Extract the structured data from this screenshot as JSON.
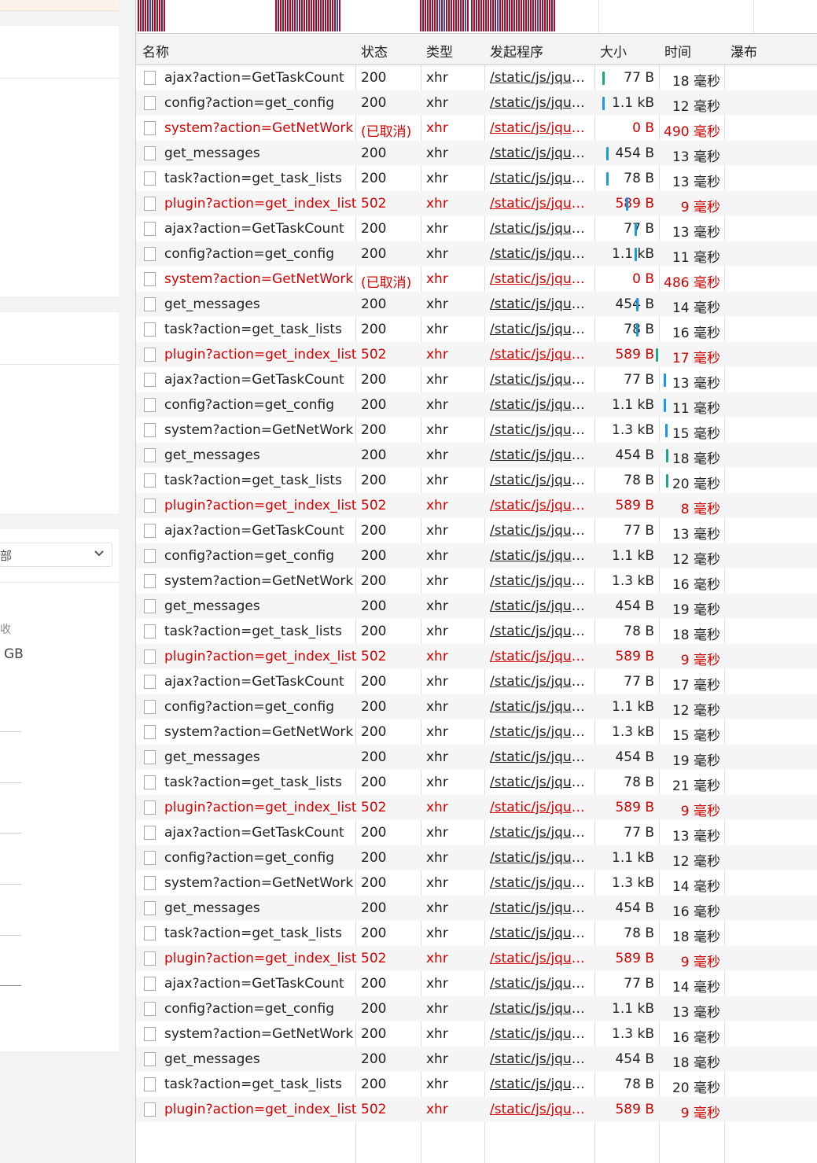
{
  "left_panel": {
    "filter_value": "部",
    "stat_label": "收",
    "stat_value": "GB"
  },
  "network": {
    "columns": {
      "name": "名称",
      "status": "状态",
      "type": "类型",
      "initiator": "发起程序",
      "size": "大小",
      "time": "时间",
      "waterfall": "瀑布"
    },
    "rows": [
      {
        "name": "ajax?action=GetTaskCount",
        "status": "200",
        "type": "xhr",
        "initiator": "/static/js/jquery",
        "size": "77 B",
        "time": "18 毫秒",
        "error": false,
        "waterfall": "teal"
      },
      {
        "name": "config?action=get_config",
        "status": "200",
        "type": "xhr",
        "initiator": "/static/js/jquery",
        "size": "1.1 kB",
        "time": "12 毫秒",
        "error": false,
        "waterfall": "blue"
      },
      {
        "name": "system?action=GetNetWork",
        "status": "(已取消)",
        "type": "xhr",
        "initiator": "/static/js/jquery",
        "size": "0 B",
        "time": "490 毫秒",
        "error": true,
        "waterfall": "none"
      },
      {
        "name": "get_messages",
        "status": "200",
        "type": "xhr",
        "initiator": "/static/js/jquery",
        "size": "454 B",
        "time": "13 毫秒",
        "error": false,
        "waterfall": "blue"
      },
      {
        "name": "task?action=get_task_lists",
        "status": "200",
        "type": "xhr",
        "initiator": "/static/js/jquery",
        "size": "78 B",
        "time": "13 毫秒",
        "error": false,
        "waterfall": "blue"
      },
      {
        "name": "plugin?action=get_index_list",
        "status": "502",
        "type": "xhr",
        "initiator": "/static/js/jquery",
        "size": "589 B",
        "time": "9 毫秒",
        "error": true,
        "waterfall": "blue"
      },
      {
        "name": "ajax?action=GetTaskCount",
        "status": "200",
        "type": "xhr",
        "initiator": "/static/js/jquery",
        "size": "77 B",
        "time": "13 毫秒",
        "error": false,
        "waterfall": "blue"
      },
      {
        "name": "config?action=get_config",
        "status": "200",
        "type": "xhr",
        "initiator": "/static/js/jquery",
        "size": "1.1 kB",
        "time": "11 毫秒",
        "error": false,
        "waterfall": "blue"
      },
      {
        "name": "system?action=GetNetWork",
        "status": "(已取消)",
        "type": "xhr",
        "initiator": "/static/js/jquery",
        "size": "0 B",
        "time": "486 毫秒",
        "error": true,
        "waterfall": "none"
      },
      {
        "name": "get_messages",
        "status": "200",
        "type": "xhr",
        "initiator": "/static/js/jquery",
        "size": "454 B",
        "time": "14 毫秒",
        "error": false,
        "waterfall": "blue"
      },
      {
        "name": "task?action=get_task_lists",
        "status": "200",
        "type": "xhr",
        "initiator": "/static/js/jquery",
        "size": "78 B",
        "time": "16 毫秒",
        "error": false,
        "waterfall": "blue"
      },
      {
        "name": "plugin?action=get_index_list",
        "status": "502",
        "type": "xhr",
        "initiator": "/static/js/jquery",
        "size": "589 B",
        "time": "17 毫秒",
        "error": true,
        "waterfall": "teal"
      },
      {
        "name": "ajax?action=GetTaskCount",
        "status": "200",
        "type": "xhr",
        "initiator": "/static/js/jquery",
        "size": "77 B",
        "time": "13 毫秒",
        "error": false,
        "waterfall": "blue"
      },
      {
        "name": "config?action=get_config",
        "status": "200",
        "type": "xhr",
        "initiator": "/static/js/jquery",
        "size": "1.1 kB",
        "time": "11 毫秒",
        "error": false,
        "waterfall": "blue"
      },
      {
        "name": "system?action=GetNetWork",
        "status": "200",
        "type": "xhr",
        "initiator": "/static/js/jquery",
        "size": "1.3 kB",
        "time": "15 毫秒",
        "error": false,
        "waterfall": "blue"
      },
      {
        "name": "get_messages",
        "status": "200",
        "type": "xhr",
        "initiator": "/static/js/jquery",
        "size": "454 B",
        "time": "18 毫秒",
        "error": false,
        "waterfall": "teal"
      },
      {
        "name": "task?action=get_task_lists",
        "status": "200",
        "type": "xhr",
        "initiator": "/static/js/jquery",
        "size": "78 B",
        "time": "20 毫秒",
        "error": false,
        "waterfall": "teal"
      },
      {
        "name": "plugin?action=get_index_list",
        "status": "502",
        "type": "xhr",
        "initiator": "/static/js/jquery",
        "size": "589 B",
        "time": "8 毫秒",
        "error": true,
        "waterfall": "none"
      },
      {
        "name": "ajax?action=GetTaskCount",
        "status": "200",
        "type": "xhr",
        "initiator": "/static/js/jquery",
        "size": "77 B",
        "time": "13 毫秒",
        "error": false,
        "waterfall": "none"
      },
      {
        "name": "config?action=get_config",
        "status": "200",
        "type": "xhr",
        "initiator": "/static/js/jquery",
        "size": "1.1 kB",
        "time": "12 毫秒",
        "error": false,
        "waterfall": "none"
      },
      {
        "name": "system?action=GetNetWork",
        "status": "200",
        "type": "xhr",
        "initiator": "/static/js/jquery",
        "size": "1.3 kB",
        "time": "16 毫秒",
        "error": false,
        "waterfall": "none"
      },
      {
        "name": "get_messages",
        "status": "200",
        "type": "xhr",
        "initiator": "/static/js/jquery",
        "size": "454 B",
        "time": "19 毫秒",
        "error": false,
        "waterfall": "none"
      },
      {
        "name": "task?action=get_task_lists",
        "status": "200",
        "type": "xhr",
        "initiator": "/static/js/jquery",
        "size": "78 B",
        "time": "18 毫秒",
        "error": false,
        "waterfall": "none"
      },
      {
        "name": "plugin?action=get_index_list",
        "status": "502",
        "type": "xhr",
        "initiator": "/static/js/jquery",
        "size": "589 B",
        "time": "9 毫秒",
        "error": true,
        "waterfall": "none"
      },
      {
        "name": "ajax?action=GetTaskCount",
        "status": "200",
        "type": "xhr",
        "initiator": "/static/js/jquery",
        "size": "77 B",
        "time": "17 毫秒",
        "error": false,
        "waterfall": "none"
      },
      {
        "name": "config?action=get_config",
        "status": "200",
        "type": "xhr",
        "initiator": "/static/js/jquery",
        "size": "1.1 kB",
        "time": "12 毫秒",
        "error": false,
        "waterfall": "none"
      },
      {
        "name": "system?action=GetNetWork",
        "status": "200",
        "type": "xhr",
        "initiator": "/static/js/jquery",
        "size": "1.3 kB",
        "time": "15 毫秒",
        "error": false,
        "waterfall": "none"
      },
      {
        "name": "get_messages",
        "status": "200",
        "type": "xhr",
        "initiator": "/static/js/jquery",
        "size": "454 B",
        "time": "19 毫秒",
        "error": false,
        "waterfall": "none"
      },
      {
        "name": "task?action=get_task_lists",
        "status": "200",
        "type": "xhr",
        "initiator": "/static/js/jquery",
        "size": "78 B",
        "time": "21 毫秒",
        "error": false,
        "waterfall": "none"
      },
      {
        "name": "plugin?action=get_index_list",
        "status": "502",
        "type": "xhr",
        "initiator": "/static/js/jquery",
        "size": "589 B",
        "time": "9 毫秒",
        "error": true,
        "waterfall": "none"
      },
      {
        "name": "ajax?action=GetTaskCount",
        "status": "200",
        "type": "xhr",
        "initiator": "/static/js/jquery",
        "size": "77 B",
        "time": "13 毫秒",
        "error": false,
        "waterfall": "none"
      },
      {
        "name": "config?action=get_config",
        "status": "200",
        "type": "xhr",
        "initiator": "/static/js/jquery",
        "size": "1.1 kB",
        "time": "12 毫秒",
        "error": false,
        "waterfall": "none"
      },
      {
        "name": "system?action=GetNetWork",
        "status": "200",
        "type": "xhr",
        "initiator": "/static/js/jquery",
        "size": "1.3 kB",
        "time": "14 毫秒",
        "error": false,
        "waterfall": "none"
      },
      {
        "name": "get_messages",
        "status": "200",
        "type": "xhr",
        "initiator": "/static/js/jquery",
        "size": "454 B",
        "time": "16 毫秒",
        "error": false,
        "waterfall": "none"
      },
      {
        "name": "task?action=get_task_lists",
        "status": "200",
        "type": "xhr",
        "initiator": "/static/js/jquery",
        "size": "78 B",
        "time": "18 毫秒",
        "error": false,
        "waterfall": "none"
      },
      {
        "name": "plugin?action=get_index_list",
        "status": "502",
        "type": "xhr",
        "initiator": "/static/js/jquery",
        "size": "589 B",
        "time": "9 毫秒",
        "error": true,
        "waterfall": "none"
      },
      {
        "name": "ajax?action=GetTaskCount",
        "status": "200",
        "type": "xhr",
        "initiator": "/static/js/jquery",
        "size": "77 B",
        "time": "14 毫秒",
        "error": false,
        "waterfall": "none"
      },
      {
        "name": "config?action=get_config",
        "status": "200",
        "type": "xhr",
        "initiator": "/static/js/jquery",
        "size": "1.1 kB",
        "time": "13 毫秒",
        "error": false,
        "waterfall": "none"
      },
      {
        "name": "system?action=GetNetWork",
        "status": "200",
        "type": "xhr",
        "initiator": "/static/js/jquery",
        "size": "1.3 kB",
        "time": "16 毫秒",
        "error": false,
        "waterfall": "none"
      },
      {
        "name": "get_messages",
        "status": "200",
        "type": "xhr",
        "initiator": "/static/js/jquery",
        "size": "454 B",
        "time": "18 毫秒",
        "error": false,
        "waterfall": "none"
      },
      {
        "name": "task?action=get_task_lists",
        "status": "200",
        "type": "xhr",
        "initiator": "/static/js/jquery",
        "size": "78 B",
        "time": "20 毫秒",
        "error": false,
        "waterfall": "none"
      },
      {
        "name": "plugin?action=get_index_list",
        "status": "502",
        "type": "xhr",
        "initiator": "/static/js/jquery",
        "size": "589 B",
        "time": "9 毫秒",
        "error": true,
        "waterfall": "none"
      }
    ]
  },
  "colors": {
    "error": "#d40000",
    "waterfall_blue": "#1a98e8",
    "waterfall_teal": "#19a889",
    "overview_red": "#a50f2e",
    "overview_blue": "#2b53b8"
  }
}
